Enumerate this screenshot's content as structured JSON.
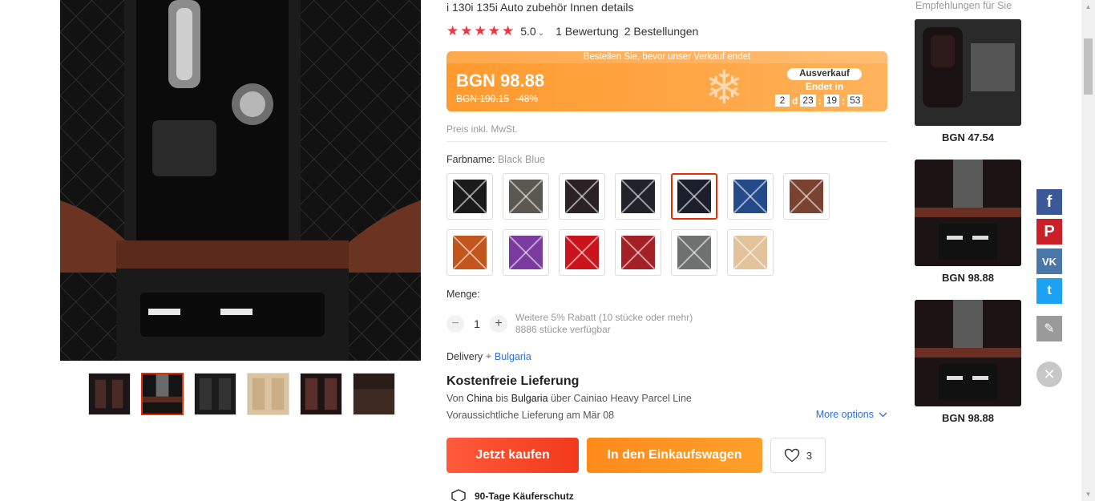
{
  "product": {
    "title_tail": "i 130i 135i Auto zubehör Innen details",
    "rating": {
      "stars": 5,
      "value": "5.0",
      "reviews": "1 Bewertung",
      "orders": "2 Bestellungen"
    },
    "price_banner": {
      "headline": "Bestellen Sie, bevor unser Verkauf endet",
      "price": "BGN 98.88",
      "old_price": "BGN 190.15",
      "discount": "-48%",
      "sale_tag": "Ausverkauf",
      "ends_in": "Endet in",
      "countdown": {
        "days": "2",
        "d_label": "d",
        "hours": "23",
        "minutes": "19",
        "seconds": "53"
      }
    },
    "tax_note": "Preis inkl. MwSt.",
    "color": {
      "label": "Farbname:",
      "selected": "Black Blue",
      "swatches": [
        {
          "name": "black-white",
          "color": "#1a1a1a"
        },
        {
          "name": "gray-beige",
          "color": "#5a5850"
        },
        {
          "name": "black-red",
          "color": "#2a2224"
        },
        {
          "name": "black-gray",
          "color": "#22232a"
        },
        {
          "name": "black-blue",
          "color": "#1b1f2c"
        },
        {
          "name": "blue",
          "color": "#244a8a"
        },
        {
          "name": "brown",
          "color": "#7a4230"
        },
        {
          "name": "orange",
          "color": "#c2551c"
        },
        {
          "name": "purple",
          "color": "#7b3a9e"
        },
        {
          "name": "red",
          "color": "#c9141c"
        },
        {
          "name": "wine-red",
          "color": "#a32026"
        },
        {
          "name": "gray",
          "color": "#6f7070"
        },
        {
          "name": "beige",
          "color": "#e2c29a"
        }
      ]
    },
    "quantity": {
      "label": "Menge:",
      "value": "1",
      "minus": "−",
      "plus": "+",
      "discount_note": "Weitere 5% Rabatt (10 stücke oder mehr)",
      "stock_note": "8886 stücke verfügbar"
    },
    "delivery": {
      "label": "Delivery",
      "country": "Bulgaria",
      "free_title": "Kostenfreie Lieferung",
      "from_prefix": "Von",
      "from": "China",
      "to_prefix": "bis",
      "to": "Bulgaria",
      "via_prefix": "über",
      "carrier": "Cainiao Heavy Parcel Line",
      "eta": "Voraussichtliche Lieferung am Mär 08",
      "more_options": "More options"
    },
    "actions": {
      "buy_now": "Jetzt kaufen",
      "add_to_cart": "In den Einkaufswagen",
      "wishlist_count": "3"
    },
    "protection": "90-Tage Käuferschutz"
  },
  "recommendations": {
    "title": "Empfehlungen für Sie",
    "items": [
      {
        "price": "BGN 47.54"
      },
      {
        "price": "BGN 98.88"
      },
      {
        "price": "BGN 98.88"
      }
    ]
  },
  "share": {
    "facebook": "f",
    "pinterest": "P",
    "vk": "VK",
    "twitter": "t",
    "edit": "✎",
    "close": "✕"
  },
  "colors": {
    "accent_red": "#e62e04",
    "star_red": "#f0353e",
    "banner_orange": "#ff9a2e",
    "link_blue": "#2e6fd3",
    "cart_orange": "#ff8a1a"
  }
}
